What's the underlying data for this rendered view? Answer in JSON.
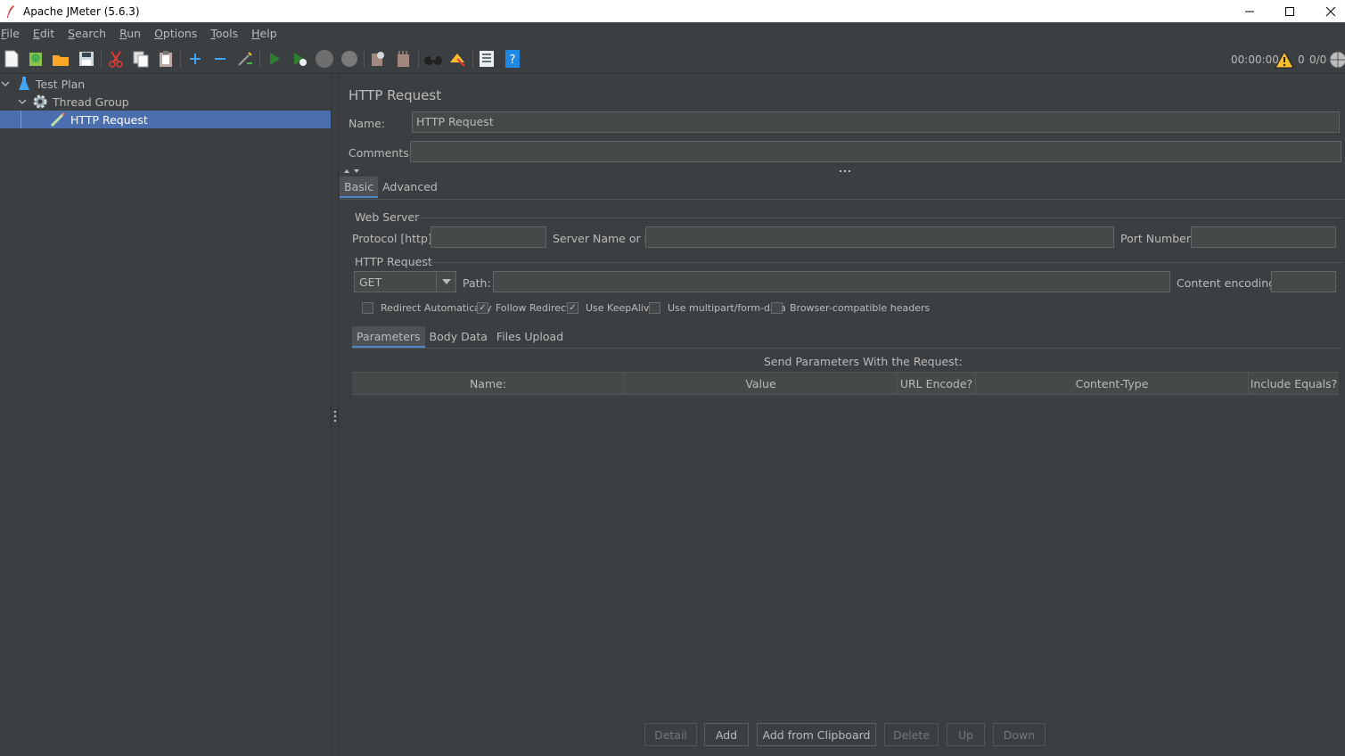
{
  "window": {
    "title": "Apache JMeter (5.6.3)"
  },
  "menu": [
    {
      "mn": "F",
      "rest": "ile"
    },
    {
      "mn": "E",
      "rest": "dit"
    },
    {
      "mn": "S",
      "rest": "earch"
    },
    {
      "mn": "R",
      "rest": "un"
    },
    {
      "mn": "O",
      "rest": "ptions"
    },
    {
      "mn": "T",
      "rest": "ools"
    },
    {
      "mn": "H",
      "rest": "elp"
    }
  ],
  "toolbar": {
    "timer": "00:00:00",
    "warnings": "0",
    "threads": "0/0"
  },
  "tree": {
    "items": [
      {
        "label": "Test Plan"
      },
      {
        "label": "Thread Group"
      },
      {
        "label": "HTTP Request"
      }
    ]
  },
  "panel": {
    "title": "HTTP Request",
    "name_label": "Name:",
    "name_value": "HTTP Request",
    "comments_label": "Comments:",
    "comments_value": "",
    "tabs": [
      "Basic",
      "Advanced"
    ],
    "web_server": {
      "title": "Web Server",
      "protocol_label": "Protocol [http]:",
      "protocol_value": "",
      "server_label": "Server Name or IP:",
      "server_value": "",
      "port_label": "Port Number:",
      "port_value": ""
    },
    "http_request": {
      "title": "HTTP Request",
      "method": "GET",
      "path_label": "Path:",
      "path_value": "",
      "encoding_label": "Content encoding:",
      "encoding_value": ""
    },
    "checkboxes": [
      {
        "label": "Redirect Automatically",
        "checked": false
      },
      {
        "label": "Follow Redirects",
        "checked": true
      },
      {
        "label": "Use KeepAlive",
        "checked": true
      },
      {
        "label": "Use multipart/form-data",
        "checked": false
      },
      {
        "label": "Browser-compatible headers",
        "checked": false
      }
    ],
    "subtabs": [
      "Parameters",
      "Body Data",
      "Files Upload"
    ],
    "params_caption": "Send Parameters With the Request:",
    "columns": [
      "Name:",
      "Value",
      "URL Encode?",
      "Content-Type",
      "Include Equals?"
    ],
    "buttons": [
      {
        "label": "Detail",
        "enabled": false
      },
      {
        "label": "Add",
        "enabled": true
      },
      {
        "label": "Add from Clipboard",
        "enabled": true
      },
      {
        "label": "Delete",
        "enabled": false
      },
      {
        "label": "Up",
        "enabled": false
      },
      {
        "label": "Down",
        "enabled": false
      }
    ]
  }
}
